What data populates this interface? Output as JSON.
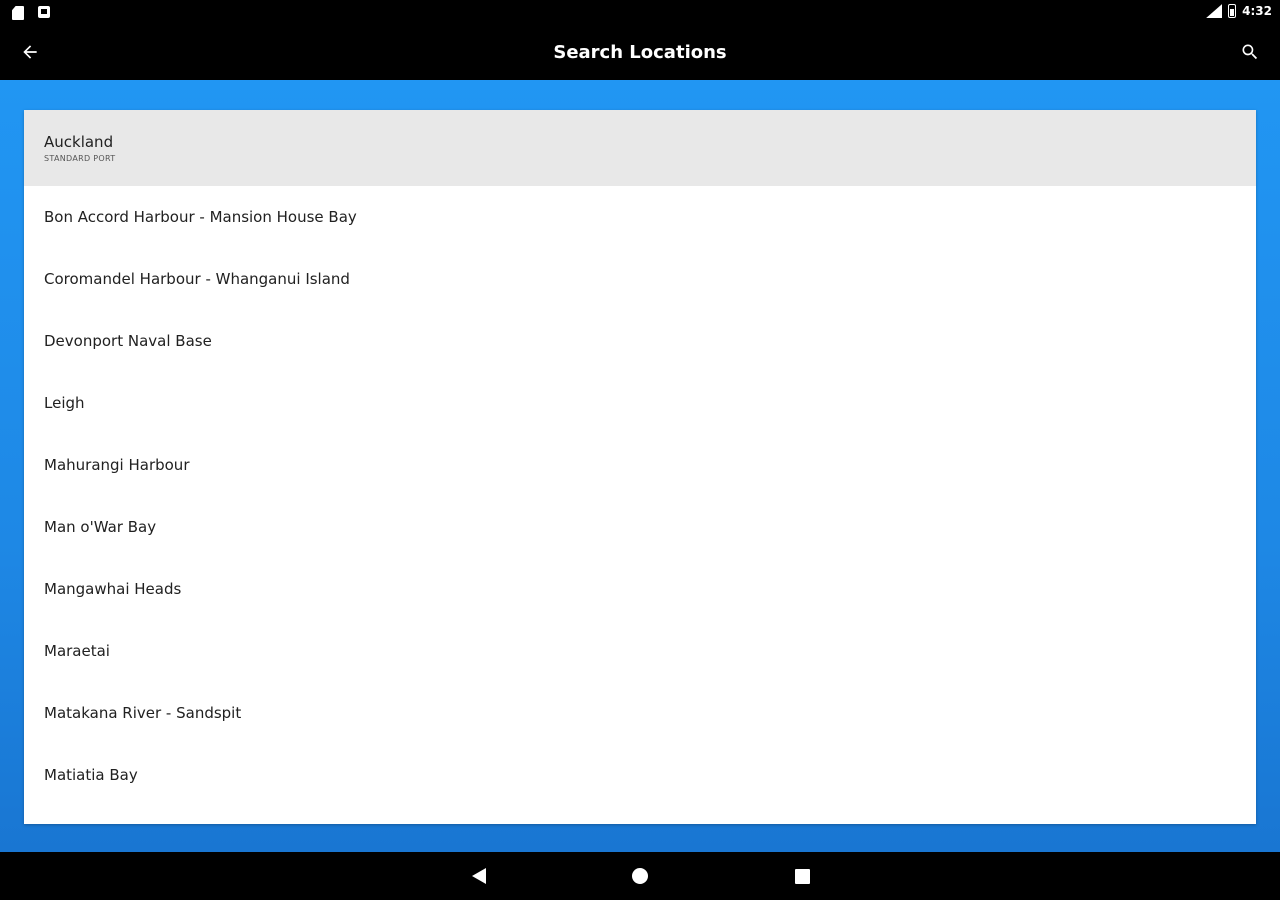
{
  "status_bar": {
    "time": "4:32",
    "left_icons": [
      "sd-card-icon",
      "notification-square-icon"
    ],
    "right_icons": [
      "signal-icon",
      "battery-icon"
    ]
  },
  "app_bar": {
    "title": "Search Locations",
    "back_icon": "arrow-back-icon",
    "search_icon": "search-icon"
  },
  "locations": [
    {
      "name": "Auckland",
      "subtitle": "STANDARD PORT",
      "selected": true
    },
    {
      "name": "Bon Accord Harbour - Mansion House Bay"
    },
    {
      "name": "Coromandel Harbour - Whanganui Island"
    },
    {
      "name": "Devonport Naval Base"
    },
    {
      "name": "Leigh"
    },
    {
      "name": "Mahurangi Harbour"
    },
    {
      "name": "Man o'War Bay"
    },
    {
      "name": "Mangawhai Heads"
    },
    {
      "name": "Maraetai"
    },
    {
      "name": "Matakana River - Sandspit"
    },
    {
      "name": "Matiatia Bay"
    }
  ],
  "nav_bar": {
    "icons": [
      "nav-back-icon",
      "nav-home-icon",
      "nav-recents-icon"
    ]
  },
  "colors": {
    "background_blue": "#2196F3",
    "app_bar": "#000000",
    "selected_row": "#e8e8e8"
  }
}
